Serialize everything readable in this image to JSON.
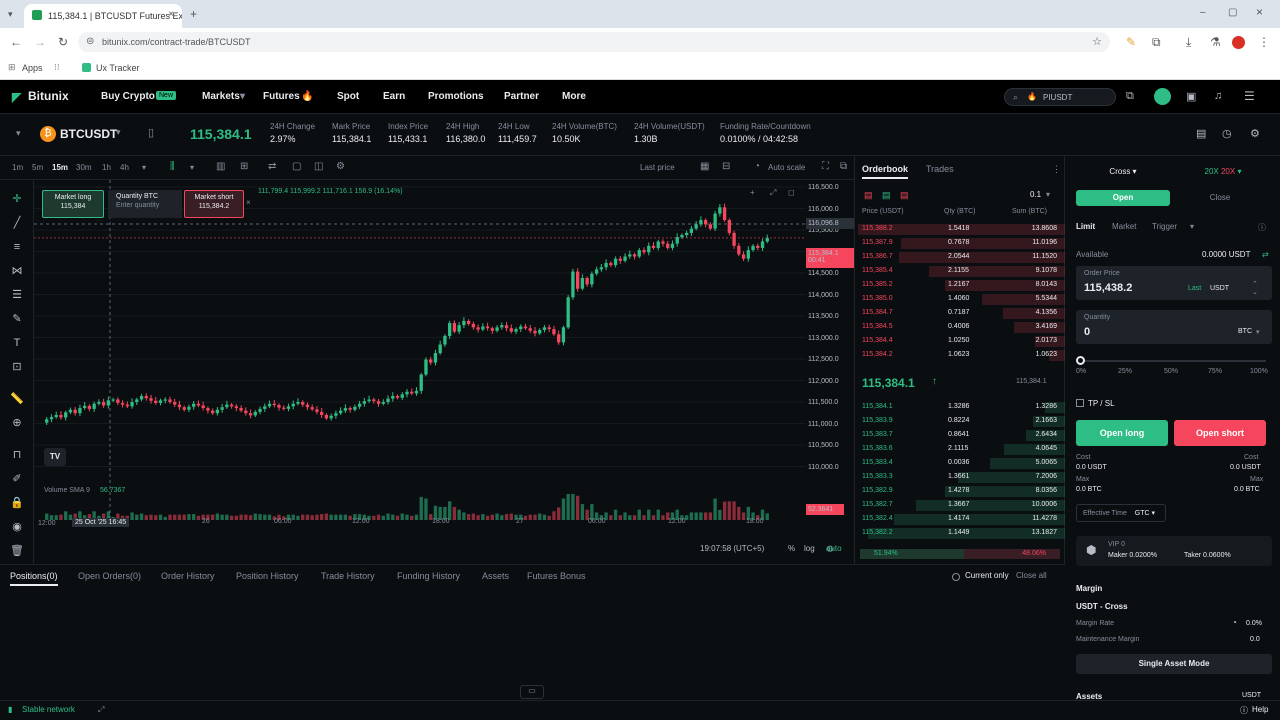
{
  "browser": {
    "tab_title": "115,384.1 | BTCUSDT Futures Ex",
    "url": "bitunix.com/contract-trade/BTCUSDT",
    "bookmarks": [
      "Apps",
      "Ux Tracker"
    ]
  },
  "nav": {
    "logo": "Bitunix",
    "items": [
      "Buy Crypto",
      "Markets",
      "Futures",
      "Spot",
      "Earn",
      "Promotions",
      "Partner",
      "More"
    ],
    "buy_badge": "New",
    "search_value": "PIUSDT"
  },
  "ticker": {
    "symbol": "BTCUSDT",
    "last_price": "115,384.1",
    "stats": [
      {
        "label": "24H Change",
        "value": "2.97%"
      },
      {
        "label": "Mark Price",
        "value": "115,384.1"
      },
      {
        "label": "Index Price",
        "value": "115,433.1"
      },
      {
        "label": "24H High",
        "value": "116,380.0"
      },
      {
        "label": "24H Low",
        "value": "111,459.7"
      },
      {
        "label": "24H Volume(BTC)",
        "value": "10.50K"
      },
      {
        "label": "24H Volume(USDT)",
        "value": "1.30B"
      },
      {
        "label": "Funding Rate/Countdown",
        "value": "0.0100% / 04:42:58"
      }
    ]
  },
  "chart": {
    "timeframes": [
      "1m",
      "5m",
      "15m",
      "30m",
      "1h",
      "4h"
    ],
    "last_price_label": "Last price",
    "auto_scale": "Auto scale",
    "ohlc": "111,799.4  115,999.2  111,716.1  156.9 (16.14%)",
    "market_long": {
      "label": "Market long",
      "value": "115,384"
    },
    "quantity": {
      "label": "Quantity BTC",
      "placeholder": "Enter quantity"
    },
    "market_short": {
      "label": "Market short",
      "value": "115,384.2"
    },
    "price_ticks": [
      "116,500.0",
      "116,000.0",
      "115,500.0",
      "115,000.0",
      "114,500.0",
      "114,000.0",
      "113,500.0",
      "113,000.0",
      "112,500.0",
      "112,000.0",
      "111,500.0",
      "111,000.0",
      "110,500.0",
      "110,000.0"
    ],
    "current_price_tag": "115,384.1",
    "current_price_sub": "00:41",
    "high_tag": "116,096.8",
    "volume_label": "Volume SMA 9",
    "volume_value": "56.7367",
    "volume_tag": "52.3641",
    "time_ticks": [
      "12:00",
      "25 Oct '25 16:45",
      "26",
      "06:00",
      "12:00",
      "18:00",
      "27",
      "06:00",
      "12:00",
      "18:00"
    ],
    "clock": "19:07:58 (UTC+5)",
    "bottom_controls": [
      "%",
      "log",
      "auto"
    ],
    "tv_logo": "TV",
    "prices_series": [
      111080,
      111160,
      111210,
      111260,
      111200,
      111320,
      111380,
      111300,
      111420,
      111470,
      111400,
      111520,
      111560,
      111480,
      111600,
      111620,
      111540,
      111500,
      111460,
      111560,
      111620,
      111700,
      111650,
      111590,
      111540,
      111600,
      111620,
      111560,
      111500,
      111440,
      111380,
      111450,
      111520,
      111480,
      111420,
      111360,
      111300,
      111380,
      111440,
      111500,
      111460,
      111420,
      111360,
      111300,
      111250,
      111330,
      111400,
      111460,
      111520,
      111490,
      111430,
      111400,
      111460,
      111520,
      111560,
      111500,
      111440,
      111390,
      111330,
      111260,
      111180,
      111240,
      111300,
      111360,
      111420,
      111380,
      111450,
      111520,
      111580,
      111620,
      111580,
      111520,
      111560,
      111640,
      111700,
      111660,
      111740,
      111800,
      111760,
      111820,
      112200,
      112550,
      112480,
      112700,
      112900,
      113100,
      113400,
      113200,
      113350,
      113450,
      113380,
      113300,
      113250,
      113320,
      113280,
      113220,
      113300,
      113350,
      113280,
      113200,
      113260,
      113320,
      113280,
      113220,
      113160,
      113240,
      113300,
      113260,
      113140,
      112950,
      113300,
      114000,
      114600,
      114200,
      114450,
      114300,
      114550,
      114650,
      114700,
      114800,
      114750,
      114900,
      114850,
      114950,
      115000,
      114950,
      115100,
      115050,
      115200,
      115150,
      115300,
      115250,
      115150,
      115250,
      115400,
      115450,
      115500,
      115600,
      115700,
      115800,
      115700,
      115600,
      115950,
      116096,
      115800,
      115500,
      115200,
      115000,
      114900,
      115100,
      115200,
      115150,
      115300,
      115384
    ]
  },
  "orderbook": {
    "tabs": [
      "Orderbook",
      "Trades"
    ],
    "precision": "0.1",
    "headers": [
      "Price (USDT)",
      "Qty (BTC)",
      "Sum (BTC)"
    ],
    "asks": [
      [
        "115,388.2",
        "1.5418",
        "13.8608"
      ],
      [
        "115,387.9",
        "0.7678",
        "11.0196"
      ],
      [
        "115,386.7",
        "2.0544",
        "11.1520"
      ],
      [
        "115,385.4",
        "2.1155",
        "9.1078"
      ],
      [
        "115,385.2",
        "1.2167",
        "8.0143"
      ],
      [
        "115,385.0",
        "1.4060",
        "5.5344"
      ],
      [
        "115,384.7",
        "0.7187",
        "4.1356"
      ],
      [
        "115,384.5",
        "0.4006",
        "3.4169"
      ],
      [
        "115,384.4",
        "1.0250",
        "2.0173"
      ],
      [
        "115,384.2",
        "1.0623",
        "1.0623"
      ]
    ],
    "mid_price": "115,384.1",
    "mid_mark": "115,384.1",
    "bids": [
      [
        "115,384.1",
        "1.3286",
        "1.3286"
      ],
      [
        "115,383.9",
        "0.8224",
        "2.1663"
      ],
      [
        "115,383.7",
        "0.8641",
        "2.6434"
      ],
      [
        "115,383.6",
        "2.1115",
        "4.0645"
      ],
      [
        "115,383.4",
        "0.0036",
        "5.0065"
      ],
      [
        "115,383.3",
        "1.3661",
        "7.2006"
      ],
      [
        "115,382.9",
        "1.4278",
        "8.0356"
      ],
      [
        "115,382.7",
        "1.3667",
        "10.0006"
      ],
      [
        "115,382.4",
        "1.4174",
        "11.4278"
      ],
      [
        "115,382.2",
        "1.1449",
        "13.1827"
      ]
    ],
    "buy_ratio": "51.94%",
    "sell_ratio": "48.06%"
  },
  "trade": {
    "mode": "Cross",
    "leverage": "20X",
    "open_tab": "Open",
    "close_tab": "Close",
    "order_types": [
      "Limit",
      "Market",
      "Trigger"
    ],
    "available_label": "Available",
    "available_value": "0.0000 USDT",
    "order_price_label": "Order Price",
    "order_price_value": "115,438.2",
    "last_label": "Last",
    "price_unit": "USDT",
    "quantity_label": "Quantity",
    "quantity_value": "0",
    "quantity_unit": "BTC",
    "slider_marks": [
      "0%",
      "25%",
      "50%",
      "75%",
      "100%"
    ],
    "tpsl_label": "TP / SL",
    "open_long": "Open long",
    "open_short": "Open short",
    "cost_label": "Cost",
    "cost_long": "0.0 USDT",
    "cost_short": "0.0 USDT",
    "max_label": "Max",
    "max_long": "0.0 BTC",
    "max_short": "0.0 BTC",
    "effective_time_label": "Effective Time",
    "effective_time_value": "GTC",
    "vip_label": "VIP 0",
    "maker_fee": "Maker 0.0200%",
    "taker_fee": "Taker 0.0600%",
    "margin_title": "Margin",
    "margin_mode": "USDT - Cross",
    "margin_rate_label": "Margin Rate",
    "margin_rate_value": "0.0%",
    "maint_margin_label": "Maintenance Margin",
    "maint_margin_value": "0.0",
    "single_asset_mode": "Single Asset Mode",
    "assets_label": "Assets",
    "assets_unit": "USDT"
  },
  "bottom": {
    "tabs": [
      "Positions(0)",
      "Open Orders(0)",
      "Order History",
      "Position History",
      "Trade History",
      "Funding History",
      "Assets",
      "Futures Bonus"
    ],
    "current_only": "Current only",
    "close_all": "Close all"
  },
  "status": {
    "network": "Stable network",
    "help": "Help"
  },
  "colors": {
    "green": "#2ebd85",
    "red": "#f6465d",
    "bg": "#0b0e11"
  }
}
